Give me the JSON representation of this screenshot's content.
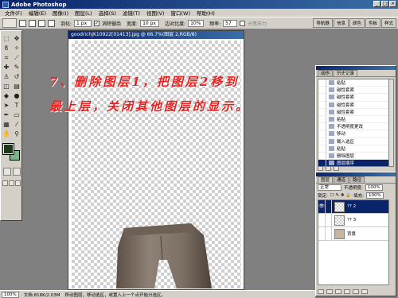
{
  "app": {
    "title": "Adobe Photoshop"
  },
  "menu": [
    "文件(F)",
    "编辑(E)",
    "图像(I)",
    "图层(L)",
    "选择(S)",
    "滤镜(T)",
    "视图(V)",
    "窗口(W)",
    "帮助(H)"
  ],
  "options": {
    "feather_label": "羽化:",
    "feather_value": "1 px",
    "antialias_label": "消除锯齿",
    "width_label": "宽度:",
    "width_value": "10 px",
    "contrast_label": "边对比度:",
    "contrast_value": "10%",
    "frequency_label": "频率:",
    "frequency_value": "57",
    "pressure_label": "光笔压力"
  },
  "palette_well": [
    "导航器",
    "信息",
    "颜色",
    "色板",
    "样式"
  ],
  "document": {
    "title": "goodrichJK10922[01413].jpg @ 66.7%(图层 2,RGB/8)"
  },
  "instruction": {
    "line1": "7、删除图层1，把图层2移到",
    "line2": "最上层，关闭其他图层的显示。"
  },
  "history": {
    "tabs": [
      "动作",
      "历史记录"
    ],
    "items": [
      "粘贴",
      "磁性套索",
      "磁性套索",
      "磁性套索",
      "磁性套索",
      "粘贴",
      "不透明度更改",
      "移动",
      "载入选区",
      "粘贴",
      "删除图层",
      "图层顺序"
    ]
  },
  "layers": {
    "tabs": [
      "图层",
      "通道",
      "路径"
    ],
    "blend_mode": "正常",
    "opacity_label": "不透明度:",
    "opacity_value": "100%",
    "lock_label": "锁定:",
    "fill_label": "填充:",
    "fill_value": "100%",
    "items": [
      {
        "name": "?? 2",
        "visible": true,
        "selected": true
      },
      {
        "name": "?? 3",
        "visible": false,
        "selected": false
      },
      {
        "name": "背景",
        "visible": false,
        "selected": false
      }
    ]
  },
  "status": {
    "zoom": "100%",
    "doc_info": "文档:818K/2.03M",
    "hint": "移动图层，移动选区，或置入上一个点开始分选区。"
  },
  "colors": {
    "foreground": "#1a3a1a",
    "background": "#76b883",
    "instruction_text": "#e8201e"
  }
}
